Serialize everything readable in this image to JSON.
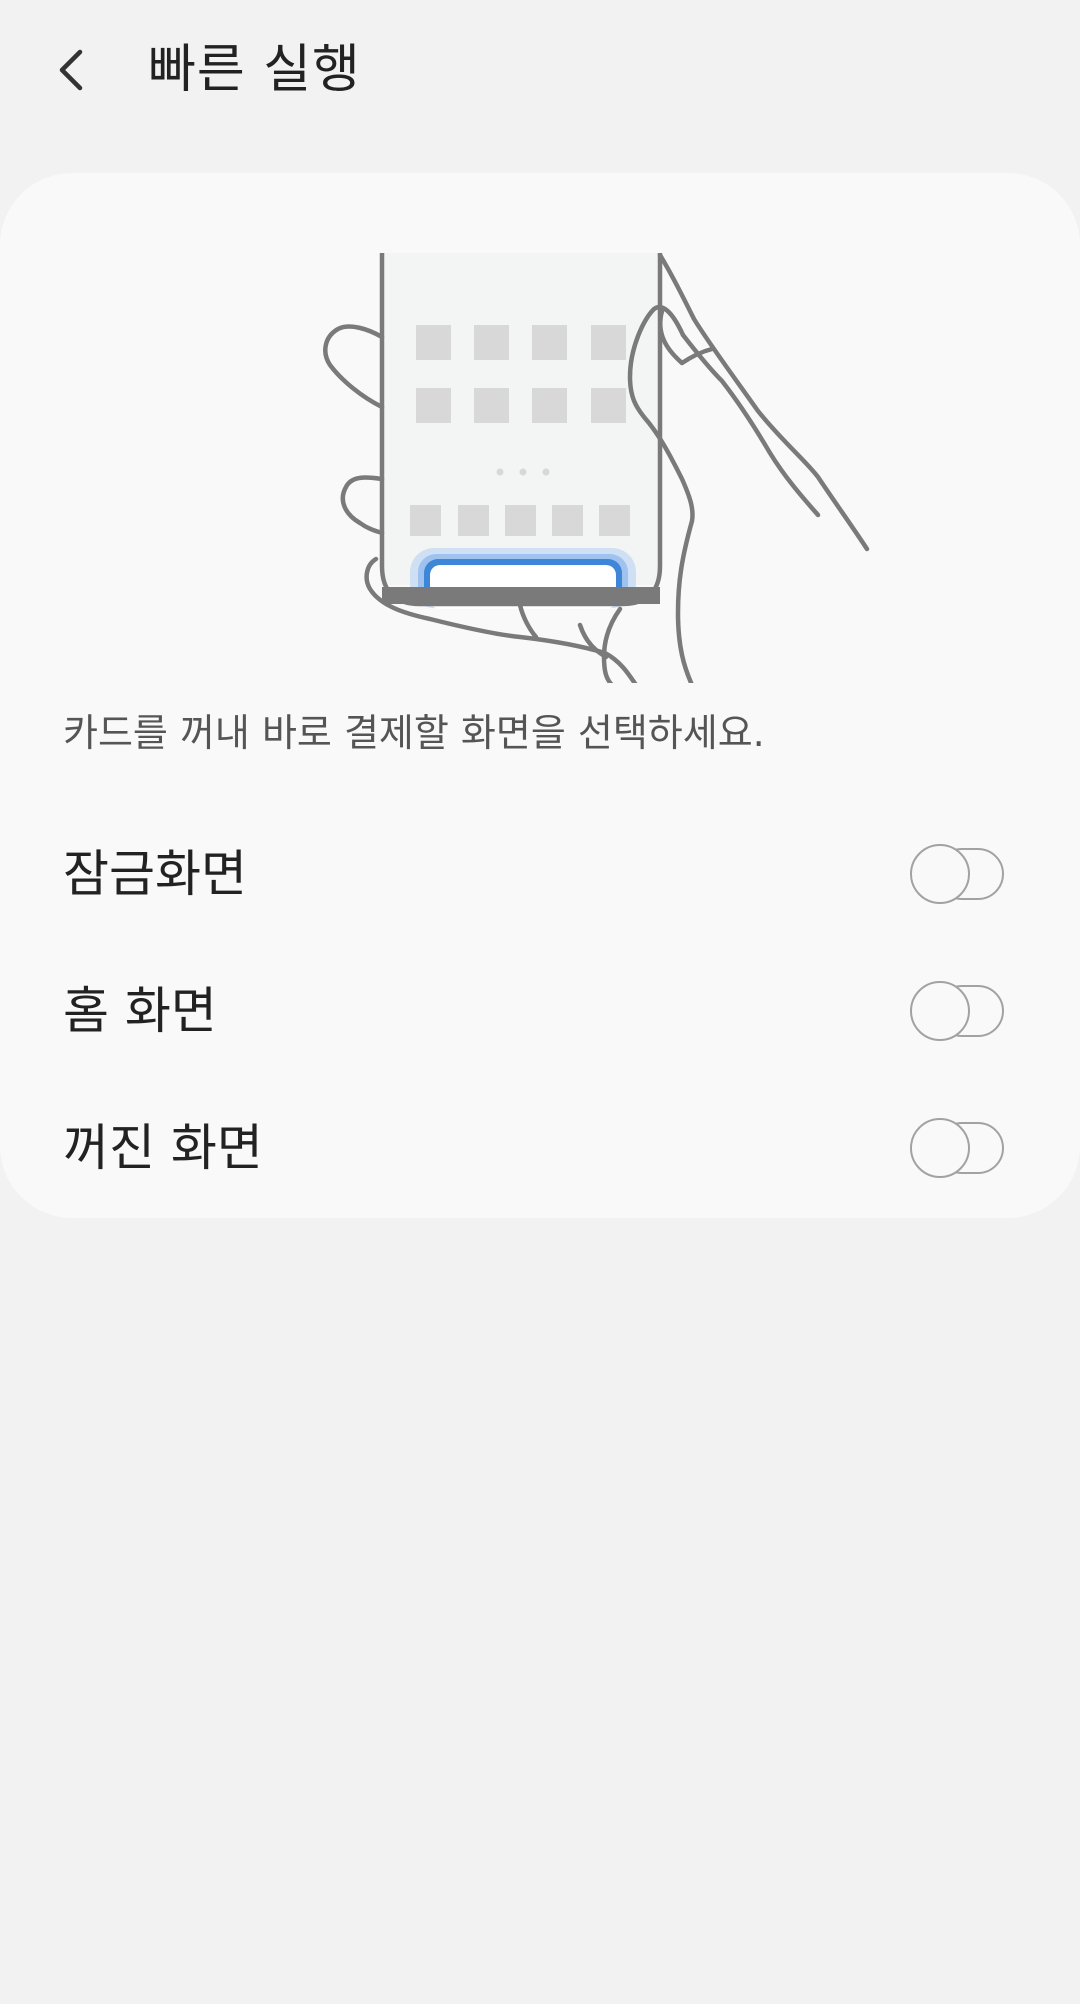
{
  "header": {
    "back_icon": "chevron-left-icon",
    "title": "빠른 실행"
  },
  "card": {
    "illustration": "hand-swipe-up-phone-illustration",
    "description": "카드를 꺼내 바로 결제할 화면을 선택하세요.",
    "options": [
      {
        "label": "잠금화면",
        "enabled": false
      },
      {
        "label": "홈 화면",
        "enabled": false
      },
      {
        "label": "꺼진 화면",
        "enabled": false
      }
    ]
  },
  "colors": {
    "background": "#f2f2f2",
    "card": "#f9f9f9",
    "text_primary": "#222222",
    "text_secondary": "#555555",
    "toggle_off": "#a2a2a2",
    "highlight": "#3d86d8"
  }
}
